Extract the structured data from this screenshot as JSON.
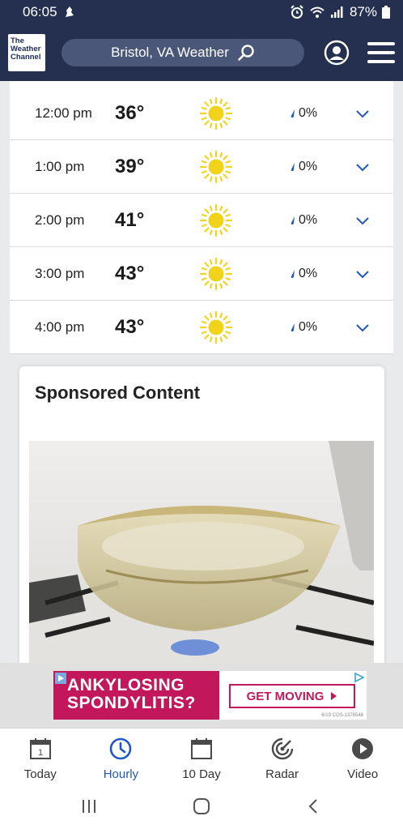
{
  "status_bar": {
    "time": "06:05",
    "battery": "87%"
  },
  "header": {
    "logo_line1": "The",
    "logo_line2": "Weather",
    "logo_line3": "Channel",
    "search_text": "Bristol, VA Weather"
  },
  "hourly": [
    {
      "time": "12:00 pm",
      "temp": "36°",
      "condition_icon": "sun-icon",
      "precip": "0%"
    },
    {
      "time": "1:00 pm",
      "temp": "39°",
      "condition_icon": "sun-icon",
      "precip": "0%"
    },
    {
      "time": "2:00 pm",
      "temp": "41°",
      "condition_icon": "sun-icon",
      "precip": "0%"
    },
    {
      "time": "3:00 pm",
      "temp": "43°",
      "condition_icon": "sun-icon",
      "precip": "0%"
    },
    {
      "time": "4:00 pm",
      "temp": "43°",
      "condition_icon": "sun-icon",
      "precip": "0%"
    }
  ],
  "sponsored": {
    "title": "Sponsored Content"
  },
  "ad": {
    "headline_line1": "ANKYLOSING",
    "headline_line2": "SPONDYLITIS?",
    "cta": "GET MOVING",
    "code": "6/19   COS-1378548",
    "accent_color": "#c2185b"
  },
  "bottom_nav": [
    {
      "label": "Today",
      "icon": "calendar-day-icon",
      "calendar_number": "1"
    },
    {
      "label": "Hourly",
      "icon": "clock-icon"
    },
    {
      "label": "10 Day",
      "icon": "calendar-icon"
    },
    {
      "label": "Radar",
      "icon": "radar-icon"
    },
    {
      "label": "Video",
      "icon": "play-icon"
    }
  ],
  "colors": {
    "header_bg": "#253050",
    "active_nav": "#1f57c3",
    "sun": "#f2d31b"
  }
}
